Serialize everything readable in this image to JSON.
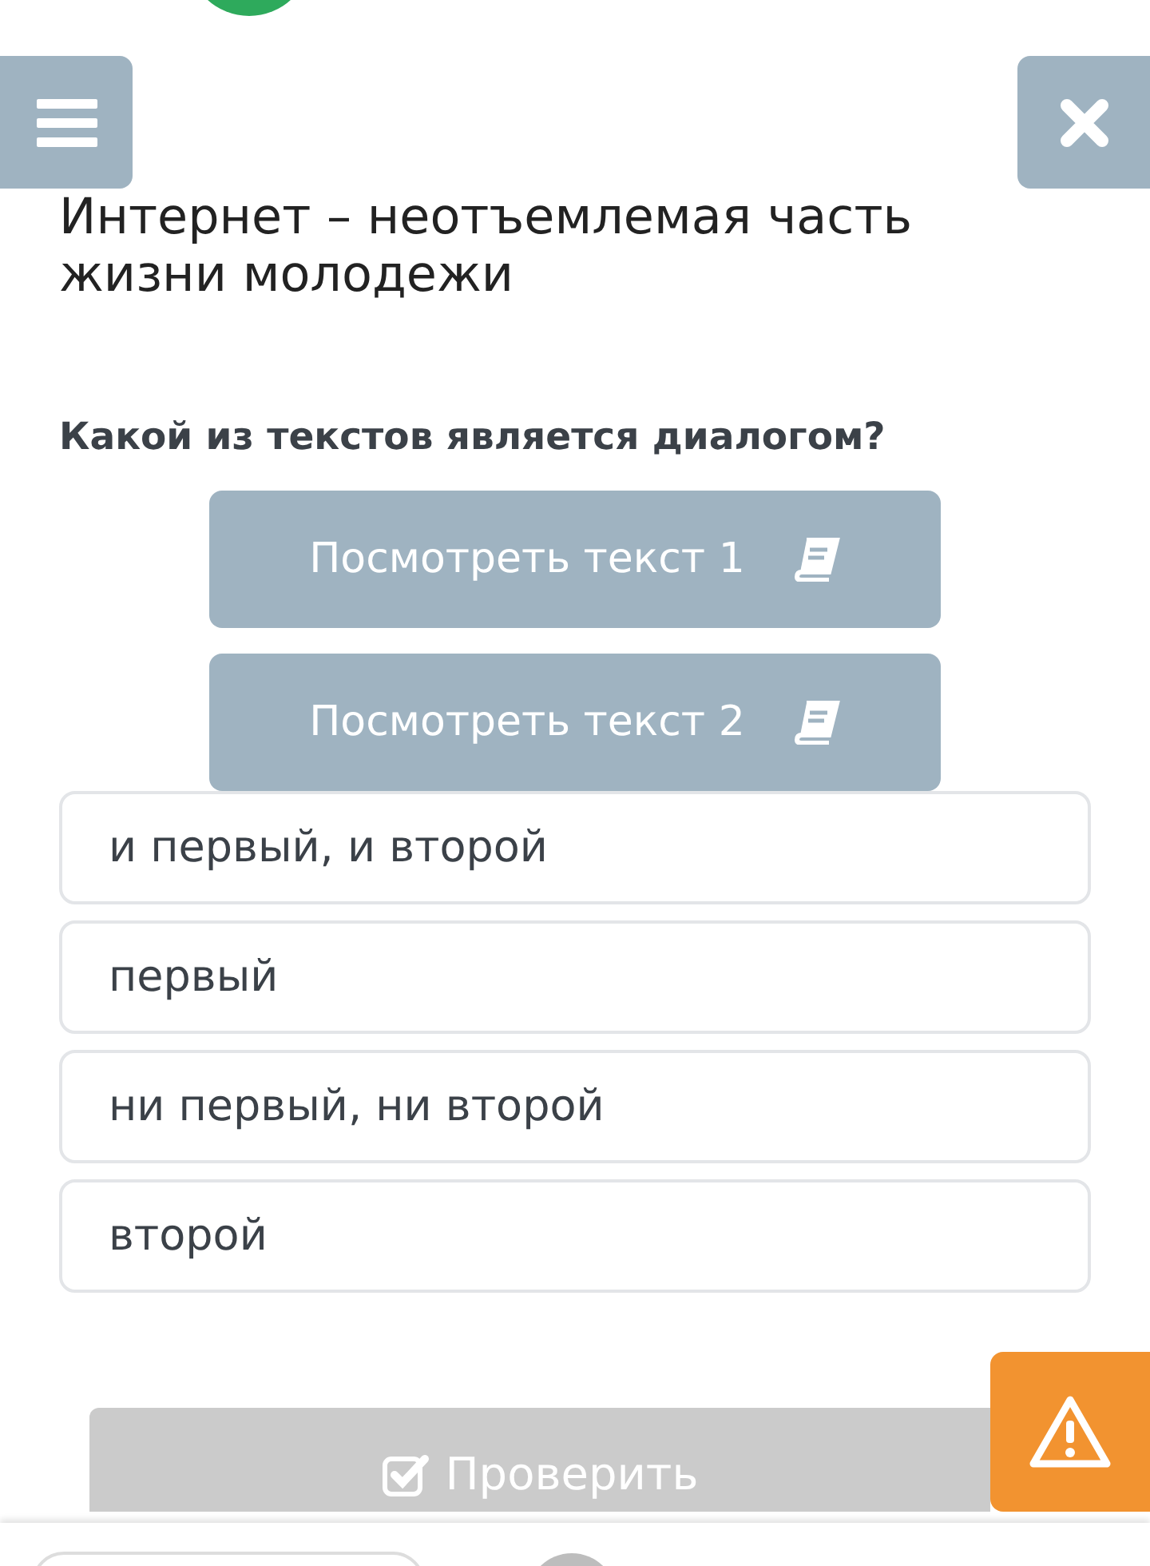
{
  "title": "Интернет – неотъемлемая часть жизни молодежи",
  "question": "Какой из текстов является диалогом?",
  "text_buttons": [
    {
      "label": "Посмотреть текст 1"
    },
    {
      "label": "Посмотреть текст 2"
    }
  ],
  "options": [
    {
      "label": "и первый, и второй"
    },
    {
      "label": "первый"
    },
    {
      "label": "ни первый, ни второй"
    },
    {
      "label": "второй"
    }
  ],
  "check_button": {
    "label": "Проверить",
    "disabled": true
  }
}
